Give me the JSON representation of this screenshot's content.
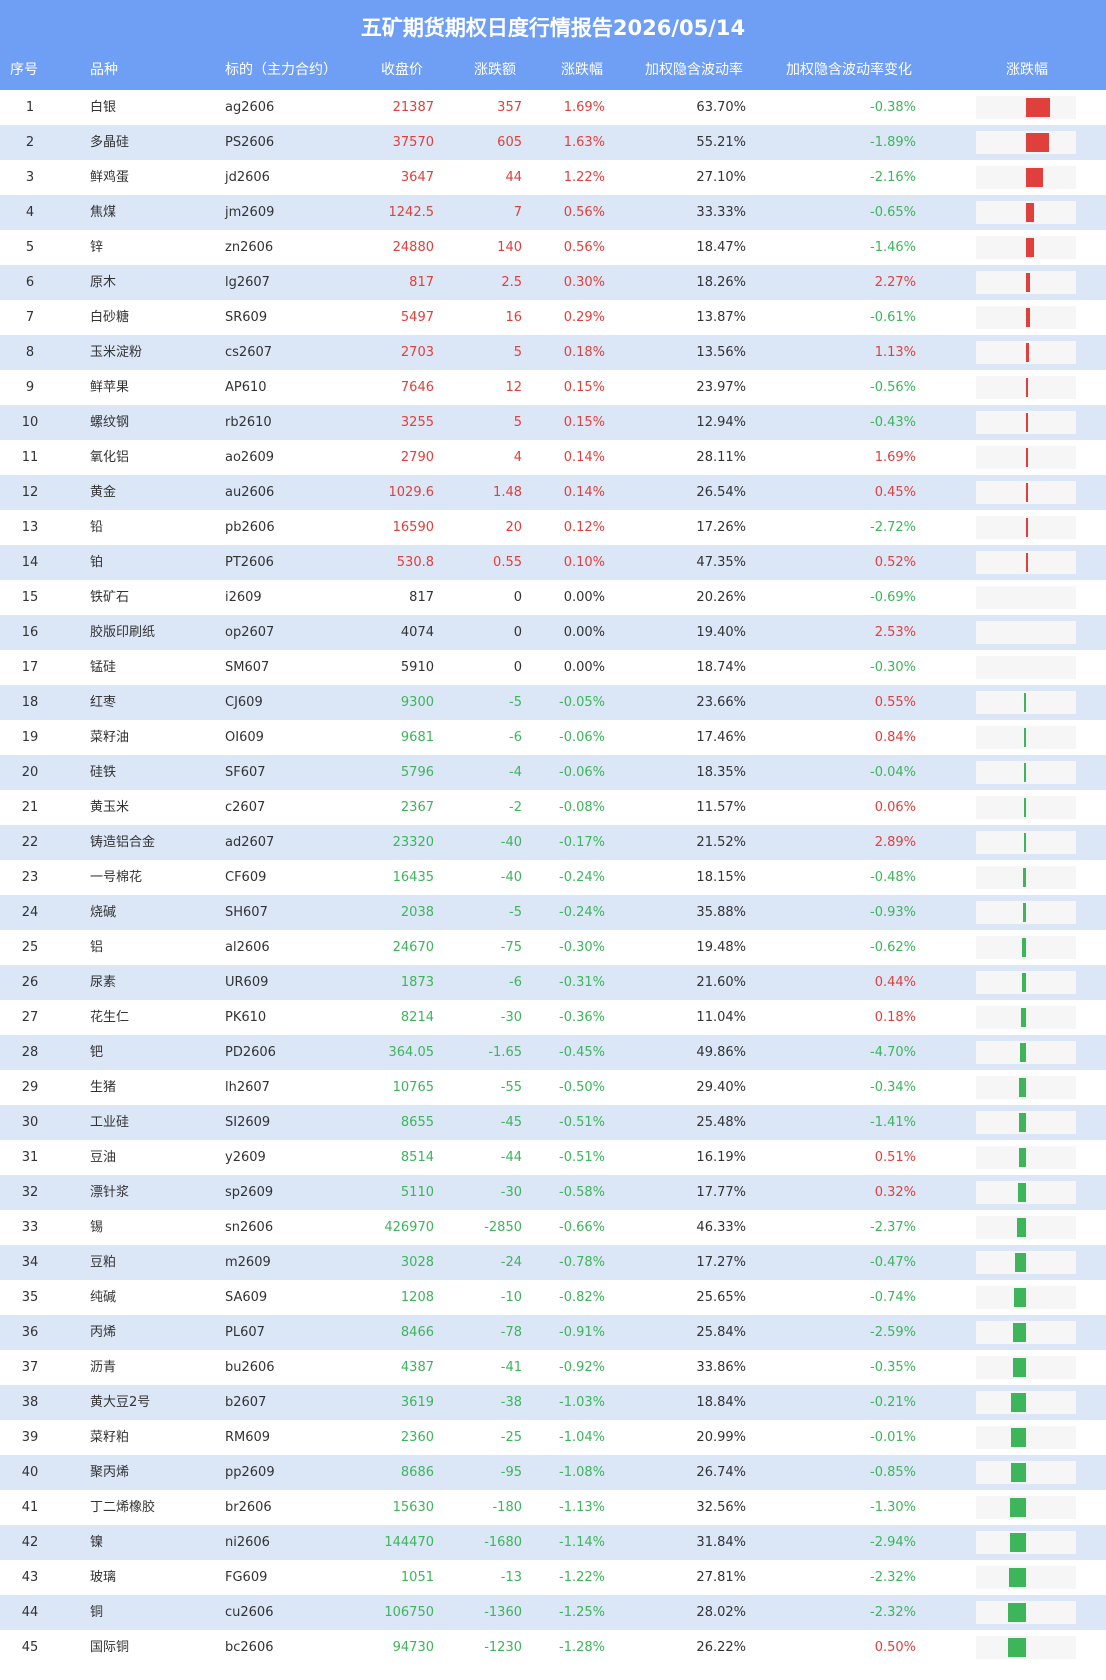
{
  "title": "五矿期货期权日度行情报告2026/05/14",
  "colors": {
    "header": "#6f9ef5",
    "up": "#e0403c",
    "down": "#3db55a",
    "row_alt": "#dbe6f7"
  },
  "columns": [
    "序号",
    "品种",
    "标的（主力合约）",
    "收盘价",
    "涨跌额",
    "涨跌幅",
    "加权隐含波动率",
    "加权隐含波动率变化",
    "涨跌幅"
  ],
  "rows": [
    {
      "idx": "1",
      "name": "白银",
      "code": "ag2606",
      "close": "21387",
      "chg": "357",
      "pct": "1.69%",
      "iv": "63.70%",
      "ivc": "-0.38%",
      "pct_value": 1.69
    },
    {
      "idx": "2",
      "name": "多晶硅",
      "code": "PS2606",
      "close": "37570",
      "chg": "605",
      "pct": "1.63%",
      "iv": "55.21%",
      "ivc": "-1.89%",
      "pct_value": 1.63
    },
    {
      "idx": "3",
      "name": "鲜鸡蛋",
      "code": "jd2606",
      "close": "3647",
      "chg": "44",
      "pct": "1.22%",
      "iv": "27.10%",
      "ivc": "-2.16%",
      "pct_value": 1.22
    },
    {
      "idx": "4",
      "name": "焦煤",
      "code": "jm2609",
      "close": "1242.5",
      "chg": "7",
      "pct": "0.56%",
      "iv": "33.33%",
      "ivc": "-0.65%",
      "pct_value": 0.56
    },
    {
      "idx": "5",
      "name": "锌",
      "code": "zn2606",
      "close": "24880",
      "chg": "140",
      "pct": "0.56%",
      "iv": "18.47%",
      "ivc": "-1.46%",
      "pct_value": 0.56
    },
    {
      "idx": "6",
      "name": "原木",
      "code": "lg2607",
      "close": "817",
      "chg": "2.5",
      "pct": "0.30%",
      "iv": "18.26%",
      "ivc": "2.27%",
      "pct_value": 0.3
    },
    {
      "idx": "7",
      "name": "白砂糖",
      "code": "SR609",
      "close": "5497",
      "chg": "16",
      "pct": "0.29%",
      "iv": "13.87%",
      "ivc": "-0.61%",
      "pct_value": 0.29
    },
    {
      "idx": "8",
      "name": "玉米淀粉",
      "code": "cs2607",
      "close": "2703",
      "chg": "5",
      "pct": "0.18%",
      "iv": "13.56%",
      "ivc": "1.13%",
      "pct_value": 0.18
    },
    {
      "idx": "9",
      "name": "鲜苹果",
      "code": "AP610",
      "close": "7646",
      "chg": "12",
      "pct": "0.15%",
      "iv": "23.97%",
      "ivc": "-0.56%",
      "pct_value": 0.15
    },
    {
      "idx": "10",
      "name": "螺纹钢",
      "code": "rb2610",
      "close": "3255",
      "chg": "5",
      "pct": "0.15%",
      "iv": "12.94%",
      "ivc": "-0.43%",
      "pct_value": 0.15
    },
    {
      "idx": "11",
      "name": "氧化铝",
      "code": "ao2609",
      "close": "2790",
      "chg": "4",
      "pct": "0.14%",
      "iv": "28.11%",
      "ivc": "1.69%",
      "pct_value": 0.14
    },
    {
      "idx": "12",
      "name": "黄金",
      "code": "au2606",
      "close": "1029.6",
      "chg": "1.48",
      "pct": "0.14%",
      "iv": "26.54%",
      "ivc": "0.45%",
      "pct_value": 0.14
    },
    {
      "idx": "13",
      "name": "铅",
      "code": "pb2606",
      "close": "16590",
      "chg": "20",
      "pct": "0.12%",
      "iv": "17.26%",
      "ivc": "-2.72%",
      "pct_value": 0.12
    },
    {
      "idx": "14",
      "name": "铂",
      "code": "PT2606",
      "close": "530.8",
      "chg": "0.55",
      "pct": "0.10%",
      "iv": "47.35%",
      "ivc": "0.52%",
      "pct_value": 0.1
    },
    {
      "idx": "15",
      "name": "铁矿石",
      "code": "i2609",
      "close": "817",
      "chg": "0",
      "pct": "0.00%",
      "iv": "20.26%",
      "ivc": "-0.69%",
      "pct_value": 0
    },
    {
      "idx": "16",
      "name": "胶版印刷纸",
      "code": "op2607",
      "close": "4074",
      "chg": "0",
      "pct": "0.00%",
      "iv": "19.40%",
      "ivc": "2.53%",
      "pct_value": 0
    },
    {
      "idx": "17",
      "name": "锰硅",
      "code": "SM607",
      "close": "5910",
      "chg": "0",
      "pct": "0.00%",
      "iv": "18.74%",
      "ivc": "-0.30%",
      "pct_value": 0
    },
    {
      "idx": "18",
      "name": "红枣",
      "code": "CJ609",
      "close": "9300",
      "chg": "-5",
      "pct": "-0.05%",
      "iv": "23.66%",
      "ivc": "0.55%",
      "pct_value": -0.05
    },
    {
      "idx": "19",
      "name": "菜籽油",
      "code": "OI609",
      "close": "9681",
      "chg": "-6",
      "pct": "-0.06%",
      "iv": "17.46%",
      "ivc": "0.84%",
      "pct_value": -0.06
    },
    {
      "idx": "20",
      "name": "硅铁",
      "code": "SF607",
      "close": "5796",
      "chg": "-4",
      "pct": "-0.06%",
      "iv": "18.35%",
      "ivc": "-0.04%",
      "pct_value": -0.06
    },
    {
      "idx": "21",
      "name": "黄玉米",
      "code": "c2607",
      "close": "2367",
      "chg": "-2",
      "pct": "-0.08%",
      "iv": "11.57%",
      "ivc": "0.06%",
      "pct_value": -0.08
    },
    {
      "idx": "22",
      "name": "铸造铝合金",
      "code": "ad2607",
      "close": "23320",
      "chg": "-40",
      "pct": "-0.17%",
      "iv": "21.52%",
      "ivc": "2.89%",
      "pct_value": -0.17
    },
    {
      "idx": "23",
      "name": "一号棉花",
      "code": "CF609",
      "close": "16435",
      "chg": "-40",
      "pct": "-0.24%",
      "iv": "18.15%",
      "ivc": "-0.48%",
      "pct_value": -0.24
    },
    {
      "idx": "24",
      "name": "烧碱",
      "code": "SH607",
      "close": "2038",
      "chg": "-5",
      "pct": "-0.24%",
      "iv": "35.88%",
      "ivc": "-0.93%",
      "pct_value": -0.24
    },
    {
      "idx": "25",
      "name": "铝",
      "code": "al2606",
      "close": "24670",
      "chg": "-75",
      "pct": "-0.30%",
      "iv": "19.48%",
      "ivc": "-0.62%",
      "pct_value": -0.3
    },
    {
      "idx": "26",
      "name": "尿素",
      "code": "UR609",
      "close": "1873",
      "chg": "-6",
      "pct": "-0.31%",
      "iv": "21.60%",
      "ivc": "0.44%",
      "pct_value": -0.31
    },
    {
      "idx": "27",
      "name": "花生仁",
      "code": "PK610",
      "close": "8214",
      "chg": "-30",
      "pct": "-0.36%",
      "iv": "11.04%",
      "ivc": "0.18%",
      "pct_value": -0.36
    },
    {
      "idx": "28",
      "name": "钯",
      "code": "PD2606",
      "close": "364.05",
      "chg": "-1.65",
      "pct": "-0.45%",
      "iv": "49.86%",
      "ivc": "-4.70%",
      "pct_value": -0.45
    },
    {
      "idx": "29",
      "name": "生猪",
      "code": "lh2607",
      "close": "10765",
      "chg": "-55",
      "pct": "-0.50%",
      "iv": "29.40%",
      "ivc": "-0.34%",
      "pct_value": -0.5
    },
    {
      "idx": "30",
      "name": "工业硅",
      "code": "SI2609",
      "close": "8655",
      "chg": "-45",
      "pct": "-0.51%",
      "iv": "25.48%",
      "ivc": "-1.41%",
      "pct_value": -0.51
    },
    {
      "idx": "31",
      "name": "豆油",
      "code": "y2609",
      "close": "8514",
      "chg": "-44",
      "pct": "-0.51%",
      "iv": "16.19%",
      "ivc": "0.51%",
      "pct_value": -0.51
    },
    {
      "idx": "32",
      "name": "漂针浆",
      "code": "sp2609",
      "close": "5110",
      "chg": "-30",
      "pct": "-0.58%",
      "iv": "17.77%",
      "ivc": "0.32%",
      "pct_value": -0.58
    },
    {
      "idx": "33",
      "name": "锡",
      "code": "sn2606",
      "close": "426970",
      "chg": "-2850",
      "pct": "-0.66%",
      "iv": "46.33%",
      "ivc": "-2.37%",
      "pct_value": -0.66
    },
    {
      "idx": "34",
      "name": "豆粕",
      "code": "m2609",
      "close": "3028",
      "chg": "-24",
      "pct": "-0.78%",
      "iv": "17.27%",
      "ivc": "-0.47%",
      "pct_value": -0.78
    },
    {
      "idx": "35",
      "name": "纯碱",
      "code": "SA609",
      "close": "1208",
      "chg": "-10",
      "pct": "-0.82%",
      "iv": "25.65%",
      "ivc": "-0.74%",
      "pct_value": -0.82
    },
    {
      "idx": "36",
      "name": "丙烯",
      "code": "PL607",
      "close": "8466",
      "chg": "-78",
      "pct": "-0.91%",
      "iv": "25.84%",
      "ivc": "-2.59%",
      "pct_value": -0.91
    },
    {
      "idx": "37",
      "name": "沥青",
      "code": "bu2606",
      "close": "4387",
      "chg": "-41",
      "pct": "-0.92%",
      "iv": "33.86%",
      "ivc": "-0.35%",
      "pct_value": -0.92
    },
    {
      "idx": "38",
      "name": "黄大豆2号",
      "code": "b2607",
      "close": "3619",
      "chg": "-38",
      "pct": "-1.03%",
      "iv": "18.84%",
      "ivc": "-0.21%",
      "pct_value": -1.03
    },
    {
      "idx": "39",
      "name": "菜籽粕",
      "code": "RM609",
      "close": "2360",
      "chg": "-25",
      "pct": "-1.04%",
      "iv": "20.99%",
      "ivc": "-0.01%",
      "pct_value": -1.04
    },
    {
      "idx": "40",
      "name": "聚丙烯",
      "code": "pp2609",
      "close": "8686",
      "chg": "-95",
      "pct": "-1.08%",
      "iv": "26.74%",
      "ivc": "-0.85%",
      "pct_value": -1.08
    },
    {
      "idx": "41",
      "name": "丁二烯橡胶",
      "code": "br2606",
      "close": "15630",
      "chg": "-180",
      "pct": "-1.13%",
      "iv": "32.56%",
      "ivc": "-1.30%",
      "pct_value": -1.13
    },
    {
      "idx": "42",
      "name": "镍",
      "code": "ni2606",
      "close": "144470",
      "chg": "-1680",
      "pct": "-1.14%",
      "iv": "31.84%",
      "ivc": "-2.94%",
      "pct_value": -1.14
    },
    {
      "idx": "43",
      "name": "玻璃",
      "code": "FG609",
      "close": "1051",
      "chg": "-13",
      "pct": "-1.22%",
      "iv": "27.81%",
      "ivc": "-2.32%",
      "pct_value": -1.22
    },
    {
      "idx": "44",
      "name": "铜",
      "code": "cu2606",
      "close": "106750",
      "chg": "-1360",
      "pct": "-1.25%",
      "iv": "28.02%",
      "ivc": "-2.32%",
      "pct_value": -1.25
    },
    {
      "idx": "45",
      "name": "国际铜",
      "code": "bc2606",
      "close": "94730",
      "chg": "-1230",
      "pct": "-1.28%",
      "iv": "26.22%",
      "ivc": "0.50%",
      "pct_value": -1.28
    }
  ]
}
